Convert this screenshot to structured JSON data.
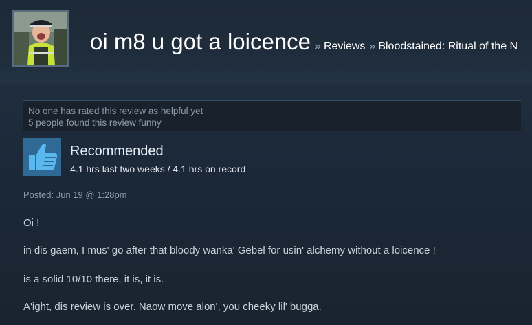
{
  "header": {
    "persona_name": "oi m8 u got a loicence",
    "separator": "»",
    "breadcrumbs": [
      "Reviews",
      "Bloodstained: Ritual of the N"
    ]
  },
  "helpful": {
    "rated_text": "No one has rated this review as helpful yet",
    "funny_text": "5 people found this review funny"
  },
  "recommendation": {
    "icon": "thumbs-up-icon",
    "title": "Recommended",
    "hours": "4.1 hrs last two weeks / 4.1 hrs on record"
  },
  "posted": "Posted: Jun 19 @ 1:28pm",
  "review": {
    "lines": [
      "Oi !",
      "in dis gaem, I mus' go after that bloody wanka' Gebel for usin' alchemy without a loicence !",
      "is a solid 10/10 there, it is, it is.",
      "A'ight, dis review is over. Naow move alon', you cheeky lil' bugga."
    ]
  },
  "colors": {
    "background": "#1b2838",
    "thumb_box": "#2f6a97",
    "text_light": "#c9d2da"
  }
}
